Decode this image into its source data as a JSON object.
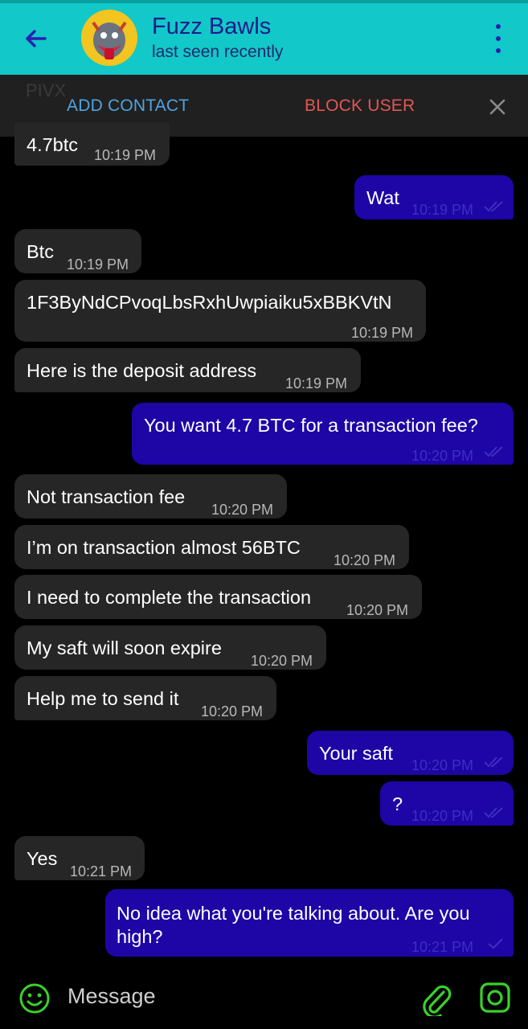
{
  "header": {
    "title": "Fuzz Bawls",
    "subtitle": "last seen recently"
  },
  "actions": {
    "faded_text": "PIVX",
    "add_contact": "ADD CONTACT",
    "block_user": "BLOCK USER"
  },
  "messages": [
    {
      "dir": "in",
      "text": "4.7btc",
      "time": "10:19 PM"
    },
    {
      "dir": "out",
      "text": "Wat",
      "time": "10:19 PM"
    },
    {
      "dir": "in",
      "text": "Btc",
      "time": "10:19 PM"
    },
    {
      "dir": "in",
      "text": "1F3ByNdCPvoqLbsRxhUwpiaiku5xBBKVtN",
      "time": "10:19 PM"
    },
    {
      "dir": "in",
      "text": "Here is the deposit address",
      "time": "10:19 PM"
    },
    {
      "dir": "out",
      "text": "You want 4.7 BTC for a transaction fee?",
      "time": "10:20 PM"
    },
    {
      "dir": "in",
      "text": "Not transaction fee",
      "time": "10:20 PM"
    },
    {
      "dir": "in",
      "text": "I’m on transaction almost 56BTC",
      "time": "10:20 PM"
    },
    {
      "dir": "in",
      "text": "I need to complete the transaction",
      "time": "10:20 PM"
    },
    {
      "dir": "in",
      "text": "My saft will soon expire",
      "time": "10:20 PM"
    },
    {
      "dir": "in",
      "text": "Help me to send it",
      "time": "10:20 PM"
    },
    {
      "dir": "out",
      "text": "Your saft",
      "time": "10:20 PM"
    },
    {
      "dir": "out",
      "text": "?",
      "time": "10:20 PM"
    },
    {
      "dir": "in",
      "text": "Yes",
      "time": "10:21 PM"
    },
    {
      "dir": "out",
      "text_line1": "No idea what you're talking about. Are you",
      "text_line2": "high?",
      "time": "10:21 PM"
    }
  ],
  "composer": {
    "placeholder": "Message"
  },
  "colors": {
    "header_bg": "#12c8c8",
    "outgoing_bubble": "#1d05a6",
    "incoming_bubble": "#262626",
    "accent_green": "#3ad12a"
  },
  "icons": {
    "back": "arrow-left-icon",
    "menu": "kebab-menu-icon",
    "close": "close-icon",
    "emoji": "emoji-icon",
    "attach": "paperclip-icon",
    "camera": "camera-icon",
    "read": "double-check-icon",
    "sent": "single-check-icon"
  }
}
